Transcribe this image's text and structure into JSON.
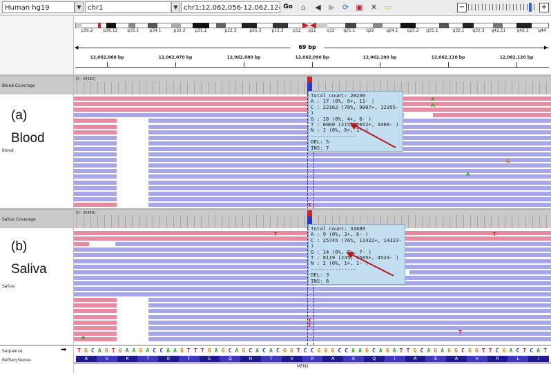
{
  "toolbar": {
    "genome": "Human hg19",
    "chromosome": "chr1",
    "locus": "chr1:12,062,056-12,062,124",
    "go_label": "Go"
  },
  "ideogram": {
    "bands": [
      "p36.2",
      "p36.12",
      "p35.1",
      "p34.1",
      "p32.2",
      "p31.2",
      "p22.3",
      "p21.3",
      "p13.3",
      "p12",
      "q11",
      "q12",
      "q21.1",
      "q22",
      "q24.1",
      "q25.2",
      "q31.1",
      "q32.1",
      "q32.3",
      "q42.11",
      "q42.3",
      "q44"
    ]
  },
  "ruler": {
    "span": "69 bp",
    "ticks": [
      "12,062,060 bp",
      "12,062,070 bp",
      "12,062,080 bp",
      "12,062,090 bp",
      "12,062,100 bp",
      "12,062,110 bp",
      "12,062,120 bp"
    ]
  },
  "blood": {
    "coverage_label": "Blood Coverage",
    "coverage_range": "[0 - 29492]",
    "panel_letter": "(a)",
    "panel_name": "Blood",
    "track_name": "blood",
    "popup": [
      "Total count: 28250",
      "A : 17 (0%, 6+, 11- )",
      "C : 22162 (78%, 9807+, 12355- )",
      "G : 10 (0%, 4+, 6- )",
      "T : 6060 (21%, 2652+, 3408- )",
      "N : 1 (0%, 0+, 1- )",
      "---------------",
      "DEL: 5",
      "INS: 7"
    ],
    "mismatch_letters": [
      "A",
      "A",
      "G",
      "A",
      "T"
    ]
  },
  "saliva": {
    "coverage_label": "Saliva Coverage",
    "coverage_range": "[0 - 35889]",
    "panel_letter": "(b)",
    "panel_name": "Saliva",
    "track_name": "Saliva",
    "popup": [
      "Total count: 33889",
      "A : 9 (0%, 3+, 6- )",
      "C : 25745 (76%, 11422+, 14323- )",
      "G : 14 (0%, 7+, 7- )",
      "T : 8119 (24%, 3595+, 4524- )",
      "N : 2 (0%, 1+, 1- )",
      "---------------",
      "DEL: 3",
      "INS: 6"
    ],
    "mismatch_letters": [
      "T",
      "T",
      "T",
      "T",
      "T",
      "A"
    ]
  },
  "sequence": {
    "label": "Sequence",
    "arrow": "➡",
    "bases": "TGCAGTGAAGACCAAGTTTGAGCAGCACACGGTCCGGGCCAAGCAGATTGCAGAGGCGGTTCGACTCAT"
  },
  "refseq": {
    "label": "RefSeq Genes",
    "amino_acids": [
      "A",
      "V",
      "K",
      "T",
      "K",
      "F",
      "E",
      "Q",
      "H",
      "T",
      "V",
      "R",
      "A",
      "K",
      "Q",
      "I",
      "A",
      "E",
      "A",
      "V",
      "R",
      "L",
      "I"
    ],
    "gene": "MFN2"
  },
  "colors": {
    "A": "#2aa12a",
    "C": "#1f3ad6",
    "G": "#d17b00",
    "T": "#d0222a",
    "pink_read": "#e88ba2",
    "purple_read": "#a8a6e6",
    "popup": "#c3ddf0",
    "arrow": "#b3191d"
  }
}
